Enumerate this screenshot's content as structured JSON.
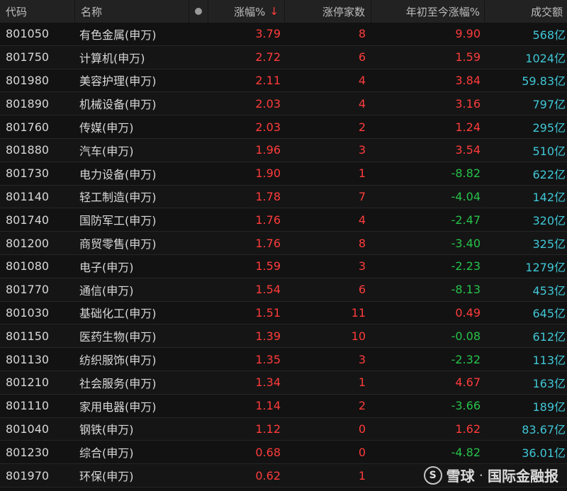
{
  "header": {
    "code": "代码",
    "name": "名称",
    "change": "涨幅%",
    "sort_arrow": "↓",
    "limit_up": "涨停家数",
    "ytd": "年初至今涨幅%",
    "volume": "成交额"
  },
  "colors": {
    "up": "#ff3b3b",
    "down": "#26c24a",
    "volume": "#3fc7d6"
  },
  "rows": [
    {
      "code": "801050",
      "name": "有色金属(申万)",
      "change": "3.79",
      "limit_up": "8",
      "ytd": "9.90",
      "volume": "568亿"
    },
    {
      "code": "801750",
      "name": "计算机(申万)",
      "change": "2.72",
      "limit_up": "6",
      "ytd": "1.59",
      "volume": "1024亿"
    },
    {
      "code": "801980",
      "name": "美容护理(申万)",
      "change": "2.11",
      "limit_up": "4",
      "ytd": "3.84",
      "volume": "59.83亿"
    },
    {
      "code": "801890",
      "name": "机械设备(申万)",
      "change": "2.03",
      "limit_up": "4",
      "ytd": "3.16",
      "volume": "797亿"
    },
    {
      "code": "801760",
      "name": "传媒(申万)",
      "change": "2.03",
      "limit_up": "2",
      "ytd": "1.24",
      "volume": "295亿"
    },
    {
      "code": "801880",
      "name": "汽车(申万)",
      "change": "1.96",
      "limit_up": "3",
      "ytd": "3.54",
      "volume": "510亿"
    },
    {
      "code": "801730",
      "name": "电力设备(申万)",
      "change": "1.90",
      "limit_up": "1",
      "ytd": "-8.82",
      "volume": "622亿"
    },
    {
      "code": "801140",
      "name": "轻工制造(申万)",
      "change": "1.78",
      "limit_up": "7",
      "ytd": "-4.04",
      "volume": "142亿"
    },
    {
      "code": "801740",
      "name": "国防军工(申万)",
      "change": "1.76",
      "limit_up": "4",
      "ytd": "-2.47",
      "volume": "320亿"
    },
    {
      "code": "801200",
      "name": "商贸零售(申万)",
      "change": "1.76",
      "limit_up": "8",
      "ytd": "-3.40",
      "volume": "325亿"
    },
    {
      "code": "801080",
      "name": "电子(申万)",
      "change": "1.59",
      "limit_up": "3",
      "ytd": "-2.23",
      "volume": "1279亿"
    },
    {
      "code": "801770",
      "name": "通信(申万)",
      "change": "1.54",
      "limit_up": "6",
      "ytd": "-8.13",
      "volume": "453亿"
    },
    {
      "code": "801030",
      "name": "基础化工(申万)",
      "change": "1.51",
      "limit_up": "11",
      "ytd": "0.49",
      "volume": "645亿"
    },
    {
      "code": "801150",
      "name": "医药生物(申万)",
      "change": "1.39",
      "limit_up": "10",
      "ytd": "-0.08",
      "volume": "612亿"
    },
    {
      "code": "801130",
      "name": "纺织服饰(申万)",
      "change": "1.35",
      "limit_up": "3",
      "ytd": "-2.32",
      "volume": "113亿"
    },
    {
      "code": "801210",
      "name": "社会服务(申万)",
      "change": "1.34",
      "limit_up": "1",
      "ytd": "4.67",
      "volume": "163亿"
    },
    {
      "code": "801110",
      "name": "家用电器(申万)",
      "change": "1.14",
      "limit_up": "2",
      "ytd": "-3.66",
      "volume": "189亿"
    },
    {
      "code": "801040",
      "name": "钢铁(申万)",
      "change": "1.12",
      "limit_up": "0",
      "ytd": "1.62",
      "volume": "83.67亿"
    },
    {
      "code": "801230",
      "name": "综合(申万)",
      "change": "0.68",
      "limit_up": "0",
      "ytd": "-4.82",
      "volume": "36.01亿"
    },
    {
      "code": "801970",
      "name": "环保(申万)",
      "change": "0.62",
      "limit_up": "1",
      "ytd": "",
      "volume": ""
    }
  ],
  "watermark": {
    "logo_glyph": "S",
    "brand": "雪球",
    "separator": "·",
    "source": "国际金融报"
  }
}
